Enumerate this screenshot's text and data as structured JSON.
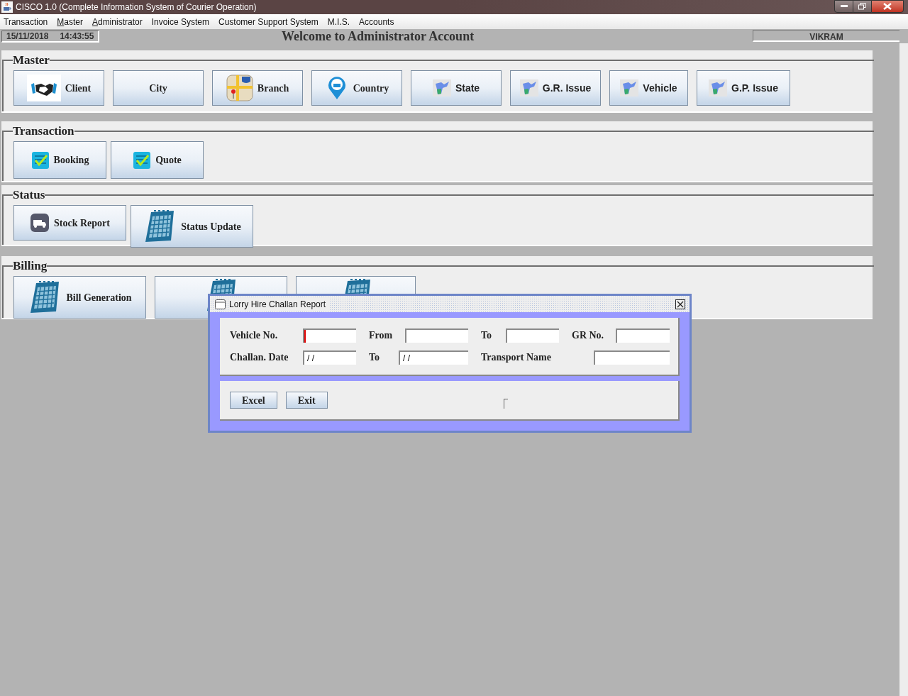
{
  "window": {
    "title": "CISCO 1.0 (Complete Information System of Courier Operation)"
  },
  "menu": [
    {
      "label": "Transaction",
      "mnemonic": false
    },
    {
      "label": "Master",
      "mnemonic": true
    },
    {
      "label": "Administrator",
      "mnemonic": true
    },
    {
      "label": "Invoice System",
      "mnemonic": false
    },
    {
      "label": "Customer Support System",
      "mnemonic": false
    },
    {
      "label": "M.I.S.",
      "mnemonic": false
    },
    {
      "label": "Accounts",
      "mnemonic": false
    }
  ],
  "status_bar": {
    "date": "15/11/2018",
    "time": "14:43:55",
    "welcome": "Welcome to Administrator Account",
    "user": "VIKRAM"
  },
  "sections": [
    {
      "title": "Master",
      "buttons": [
        {
          "label": "Client"
        },
        {
          "label": "City"
        },
        {
          "label": "Branch"
        },
        {
          "label": "Country"
        },
        {
          "label": "State"
        },
        {
          "label": "G.R. Issue"
        },
        {
          "label": "Vehicle"
        },
        {
          "label": "G.P. Issue"
        }
      ]
    },
    {
      "title": "Transaction",
      "buttons": [
        {
          "label": "Booking"
        },
        {
          "label": "Quote"
        }
      ]
    },
    {
      "title": "Status",
      "buttons": [
        {
          "label": "Stock Report"
        },
        {
          "label": "Status Update"
        }
      ]
    },
    {
      "title": "Billing",
      "buttons": [
        {
          "label": "Bill Generation",
          "covered": false
        },
        {
          "covered": true
        },
        {
          "covered": true
        }
      ]
    }
  ],
  "dialog": {
    "title": "Lorry Hire Challan Report",
    "rows": [
      [
        {
          "label": "Vehicle No.",
          "focused": true
        },
        {
          "label": "From",
          "focused": false
        },
        {
          "label": "To",
          "focused": false
        },
        {
          "label": "GR No.",
          "focused": false
        }
      ],
      [
        {
          "label": "Challan. Date",
          "value": "/ /",
          "focused": false
        },
        {
          "label": "To",
          "value": "/ /",
          "focused": false
        },
        {
          "label": "Transport Name",
          "focused": false
        }
      ]
    ],
    "buttons": [
      "Excel",
      "Exit"
    ]
  }
}
